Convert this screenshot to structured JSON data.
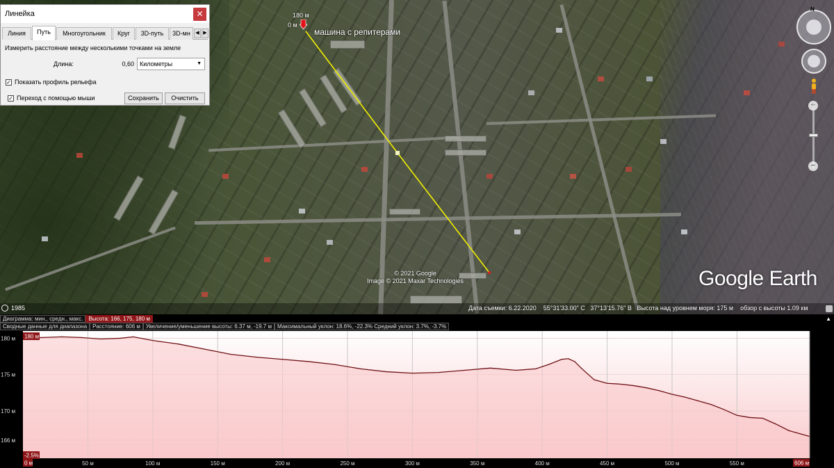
{
  "ruler": {
    "title": "Линейка",
    "tabs": [
      "Линия",
      "Путь",
      "Многоугольник",
      "Круг",
      "3D-путь",
      "3D-мн"
    ],
    "active_tab": "Путь",
    "description": "Измерить расстояние между несколькими точками на земле",
    "length_label": "Длина:",
    "length_value": "0,60",
    "unit": "Километры",
    "show_profile_label": "Показать профиль рельефа",
    "mouse_nav_label": "Переход с помощью мыши",
    "save_label": "Сохранить",
    "clear_label": "Очистить"
  },
  "map": {
    "placemark_label": "машина с репитерами",
    "start_alt_label": "180 м",
    "start_dist_label": "0 м",
    "copyright_1": "© 2021 Google",
    "copyright_2": "Image © 2021 Maxar Technologies",
    "logo": "Google Earth",
    "north_label": "N",
    "timeline_year": "1985",
    "status": {
      "date": "Дата съемки: 6.22.2020",
      "lat": "55°31'33.00\" С",
      "lon": "37°13'15.76\" В",
      "altitude": "Высота над уровнем моря:  175 м",
      "eye": "обзор с высоты   1.09 км"
    },
    "route_color": "#f2f000"
  },
  "profile": {
    "row1": {
      "label": "Диаграмма: мин., средн., макс.",
      "heights": "Высота: 166, 175, 180 м"
    },
    "row2": {
      "label": "Сводные данные для диапазона",
      "distance": "Расстояние: 606 м",
      "gain": "Увеличение/уменьшение высоты: 6.37 м, -19.7 м",
      "slope": "Максимальный уклон: 18.6%, -22.3% Средний уклон: 3.7%, -3.7%"
    },
    "max_badge": "180 м",
    "min_badge": "-2.5%",
    "start_badge": "0 м",
    "end_badge": "606 м",
    "y_ticks": [
      "180 м",
      "175 м",
      "170 м",
      "166 м"
    ],
    "x_ticks": [
      "50 м",
      "100 м",
      "150 м",
      "200 м",
      "250 м",
      "300 м",
      "350 м",
      "400 м",
      "450 м",
      "500 м",
      "550 м"
    ],
    "colors": {
      "fill": "#f9c9cb",
      "line": "#6e1014",
      "highlight": "#8e1518"
    }
  },
  "chart_data": {
    "type": "area",
    "xlabel": "",
    "ylabel": "",
    "x_unit": "м",
    "y_unit": "м",
    "xlim": [
      0,
      606
    ],
    "ylim": [
      163.5,
      181
    ],
    "grid": true,
    "x": [
      0,
      15,
      30,
      45,
      60,
      75,
      85,
      100,
      120,
      140,
      160,
      180,
      200,
      220,
      240,
      260,
      280,
      300,
      320,
      340,
      360,
      380,
      395,
      405,
      415,
      420,
      425,
      430,
      440,
      450,
      460,
      470,
      480,
      490,
      500,
      510,
      520,
      530,
      540,
      550,
      560,
      570,
      580,
      590,
      600,
      606
    ],
    "values": [
      180,
      180.1,
      180.2,
      180.1,
      179.9,
      180,
      180.2,
      179.7,
      179.2,
      178.5,
      177.8,
      177.4,
      177.1,
      176.8,
      176.4,
      175.8,
      175.4,
      175.2,
      175.3,
      175.6,
      175.9,
      175.6,
      175.8,
      176.4,
      177.1,
      177.2,
      176.8,
      175.9,
      174.3,
      173.8,
      173.7,
      173.5,
      173.2,
      172.8,
      172.3,
      171.9,
      171.4,
      170.9,
      170.2,
      169.4,
      169.1,
      169,
      168.2,
      167.3,
      166.8,
      166.5
    ]
  }
}
